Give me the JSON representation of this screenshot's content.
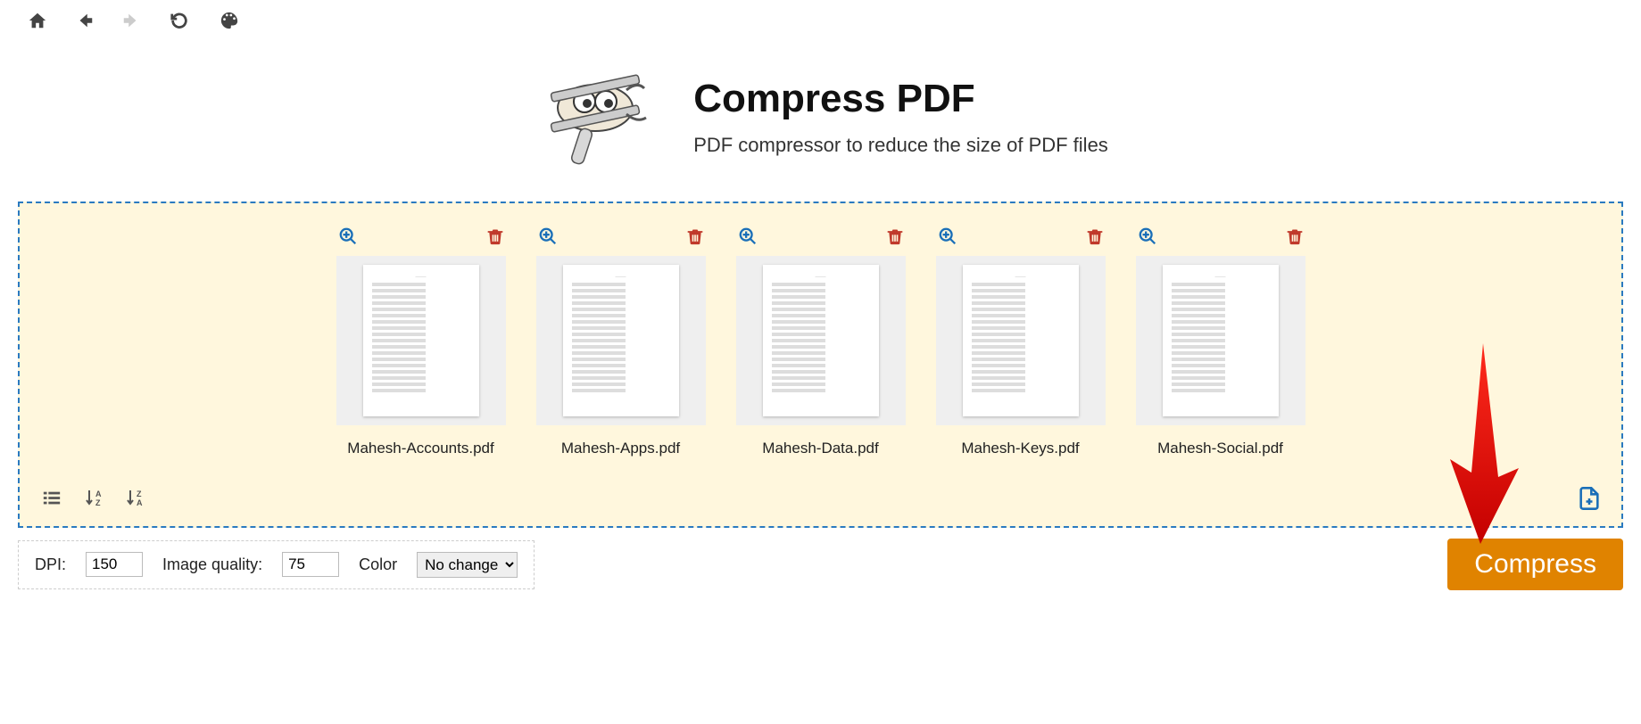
{
  "header": {
    "title": "Compress PDF",
    "subtitle": "PDF compressor to reduce the size of PDF files"
  },
  "files": [
    {
      "name": "Mahesh-Accounts.pdf"
    },
    {
      "name": "Mahesh-Apps.pdf"
    },
    {
      "name": "Mahesh-Data.pdf"
    },
    {
      "name": "Mahesh-Keys.pdf"
    },
    {
      "name": "Mahesh-Social.pdf"
    }
  ],
  "options": {
    "dpi_label": "DPI:",
    "dpi_value": "150",
    "quality_label": "Image quality:",
    "quality_value": "75",
    "color_label": "Color",
    "color_value": "No change"
  },
  "actions": {
    "compress_label": "Compress"
  }
}
